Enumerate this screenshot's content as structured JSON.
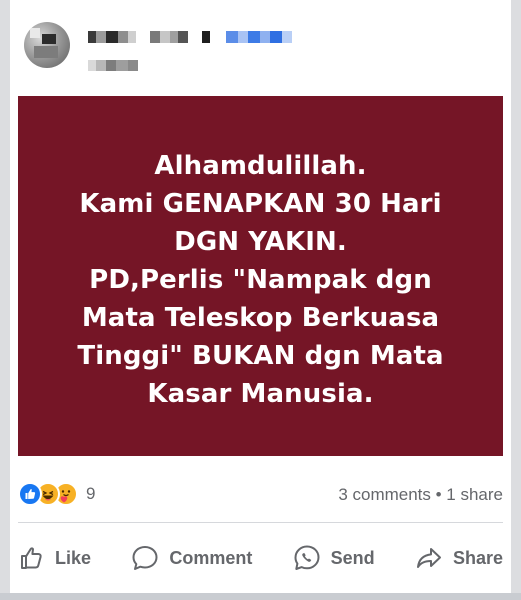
{
  "post": {
    "image_text_lines": "Alhamdulillah.\nKami GENAPKAN 30 Hari\nDGN YAKIN.\nPD,Perlis \"Nampak dgn\nMata Teleskop Berkuasa\nTinggi\" BUKAN dgn Mata\nKasar Manusia.",
    "image_bg_color": "#751526"
  },
  "stats": {
    "reaction_count": "9",
    "comments_shares": "3 comments • 1 share",
    "reaction_icons": [
      "like-icon",
      "haha-icon",
      "care-icon"
    ]
  },
  "actions": {
    "like_label": "Like",
    "comment_label": "Comment",
    "send_label": "Send",
    "share_label": "Share"
  },
  "colors": {
    "accent": "#1877f2",
    "muted_text": "#65676b"
  }
}
